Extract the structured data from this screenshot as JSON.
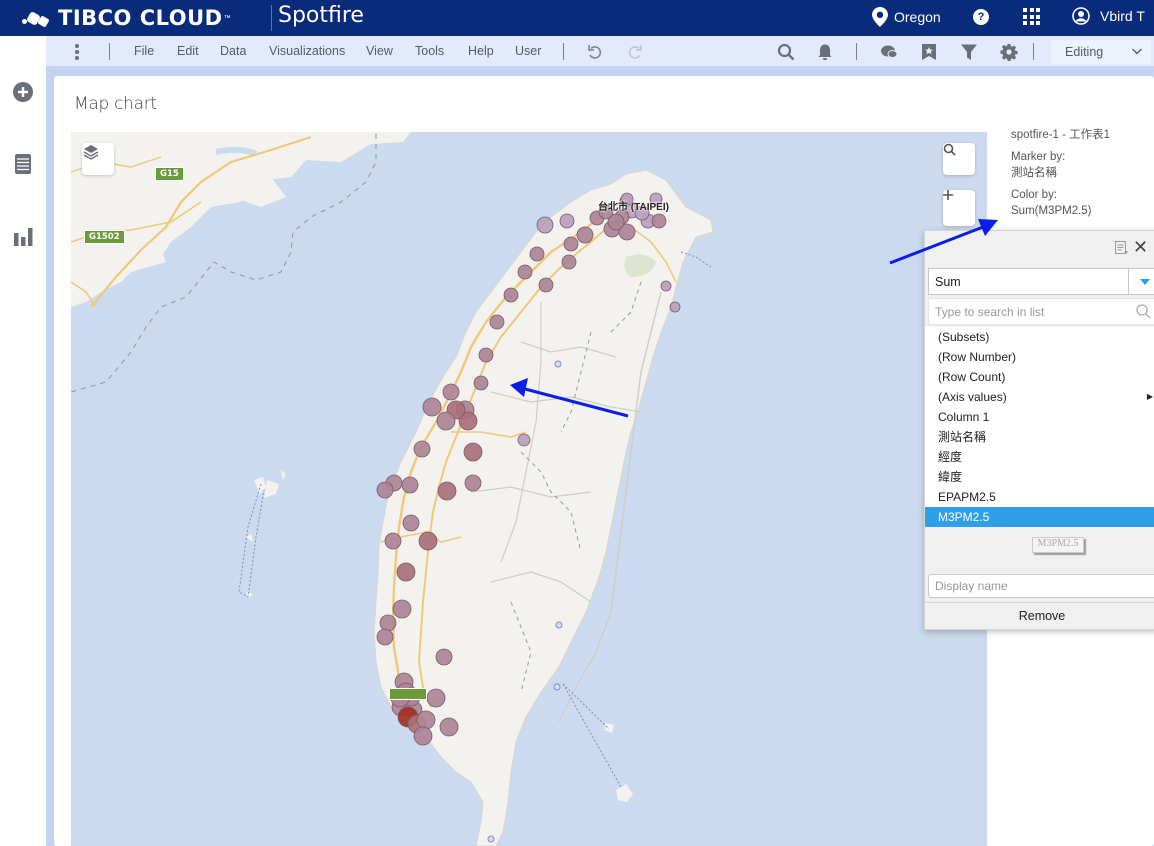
{
  "topbar": {
    "brand": "TIBCO CLOUD",
    "brand_tm": "™",
    "product": "Spotfire",
    "region": "Oregon",
    "user": "Vbird T",
    "icons": [
      "location-pin-icon",
      "help-icon",
      "apps-grid-icon",
      "user-avatar-icon"
    ]
  },
  "leftrail": {
    "items": [
      {
        "icon": "add-icon",
        "label": "Add"
      },
      {
        "icon": "data-table-icon",
        "label": "Data"
      },
      {
        "icon": "bar-chart-icon",
        "label": "Visualizations"
      }
    ]
  },
  "menubar": {
    "items": [
      "File",
      "Edit",
      "Data",
      "Visualizations",
      "View",
      "Tools",
      "Help",
      "User"
    ],
    "tools": [
      "undo-icon",
      "redo-icon",
      "search-icon",
      "notification-bell-icon",
      "comments-icon",
      "bookmark-icon",
      "filter-icon",
      "settings-gear-icon"
    ],
    "mode": "Editing"
  },
  "visualization": {
    "title": "Map chart",
    "legend": {
      "source": "spotfire-1 - 工作表1",
      "marker_by_label": "Marker by:",
      "marker_by_value": "測站名稱",
      "color_by_label": "Color by:",
      "color_by_value": "Sum(M3PM2.5)"
    },
    "map": {
      "city_label": "台北市 (TAIPEI)",
      "road_shields": [
        "G15",
        "G1502"
      ],
      "colors": {
        "sea": "#cbdaee",
        "land": "#f3f2ef",
        "road": "#f0c978",
        "marker_low": "#b394b0",
        "marker_mid": "#a9707c",
        "marker_high": "#a83a2e"
      }
    }
  },
  "popup": {
    "aggregation": "Sum",
    "search_placeholder": "Type to search in list",
    "columns": [
      {
        "label": "(Subsets)",
        "submenu": false,
        "selected": false
      },
      {
        "label": "(Row Number)",
        "submenu": false,
        "selected": false
      },
      {
        "label": "(Row Count)",
        "submenu": false,
        "selected": false
      },
      {
        "label": "(Axis values)",
        "submenu": true,
        "selected": false
      },
      {
        "label": "Column 1",
        "submenu": false,
        "selected": false
      },
      {
        "label": "測站名稱",
        "submenu": false,
        "selected": false
      },
      {
        "label": "經度",
        "submenu": false,
        "selected": false
      },
      {
        "label": "緯度",
        "submenu": false,
        "selected": false
      },
      {
        "label": "EPAPM2.5",
        "submenu": false,
        "selected": false
      },
      {
        "label": "M3PM2.5",
        "submenu": false,
        "selected": true
      }
    ],
    "drag_preview": "M3PM2.5",
    "display_name_placeholder": "Display name",
    "remove_label": "Remove",
    "accent": "#2f9fe8"
  }
}
